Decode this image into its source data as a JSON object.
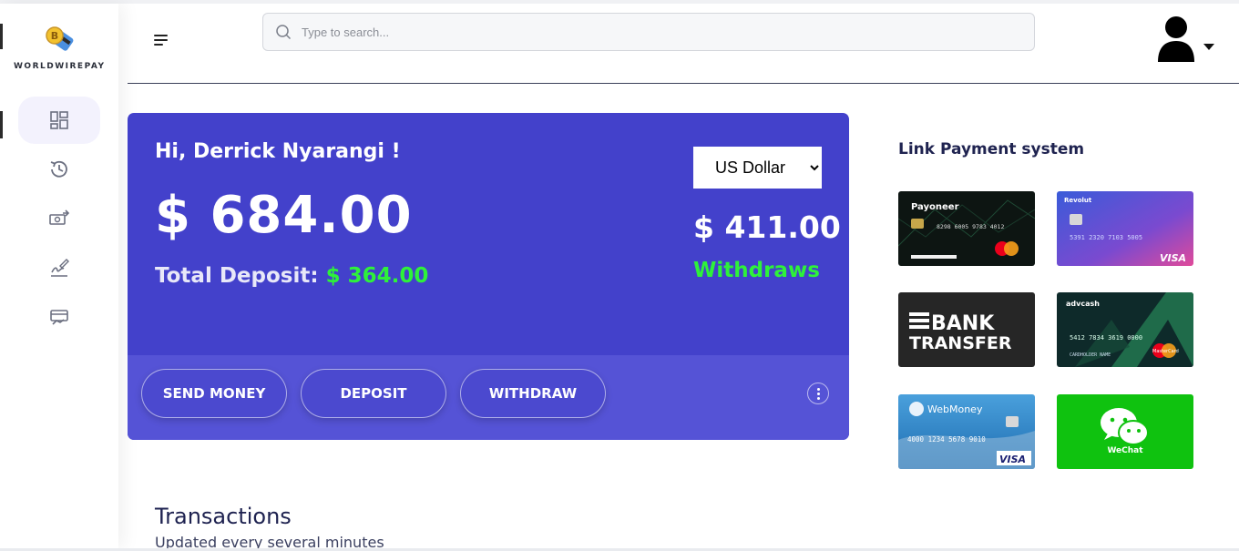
{
  "brand": {
    "name": "WORLDWIREPAY"
  },
  "search": {
    "placeholder": "Type to search..."
  },
  "sidebar": {
    "items": [
      {
        "name": "dashboard",
        "icon": "dashboard-icon",
        "active": true
      },
      {
        "name": "history",
        "icon": "history-icon"
      },
      {
        "name": "transfer",
        "icon": "money-transfer-icon"
      },
      {
        "name": "sign",
        "icon": "signature-icon"
      },
      {
        "name": "payments",
        "icon": "card-payment-icon"
      }
    ]
  },
  "card": {
    "greeting": "Hi, Derrick Nyarangi !",
    "balance": "$ 684.00",
    "deposit_label": "Total Deposit:",
    "deposit_value": "$ 364.00",
    "currency_selected": "US Dollar",
    "withdraw_amount": "$ 411.00",
    "withdraw_label": "Withdraws",
    "buttons": {
      "send": "SEND MONEY",
      "deposit": "DEPOSIT",
      "withdraw": "WITHDRAW"
    }
  },
  "payment": {
    "title": "Link Payment system",
    "systems": [
      {
        "name": "Payoneer",
        "card_number": "8298  6005  9783  4012"
      },
      {
        "name": "Revolut",
        "card_number": "5391 2320 7103 5005",
        "brand": "VISA"
      },
      {
        "name": "Bank Transfer",
        "line1": "BANK",
        "line2": "TRANSFER"
      },
      {
        "name": "advcash",
        "card_number": "5412 7834 3619 0000",
        "holder": "CARDHOLDER NAME",
        "brand": "MasterCard"
      },
      {
        "name": "WebMoney",
        "card_number": "4000 1234 5678 9010",
        "brand": "VISA"
      },
      {
        "name": "WeChat"
      }
    ]
  },
  "transactions": {
    "title": "Transactions",
    "subtitle": "Updated every several minutes"
  },
  "colors": {
    "card_bg": "#4341cb",
    "card_bottom": "#5553d6",
    "accent_green": "#2ef13a",
    "title_navy": "#1f2350"
  }
}
